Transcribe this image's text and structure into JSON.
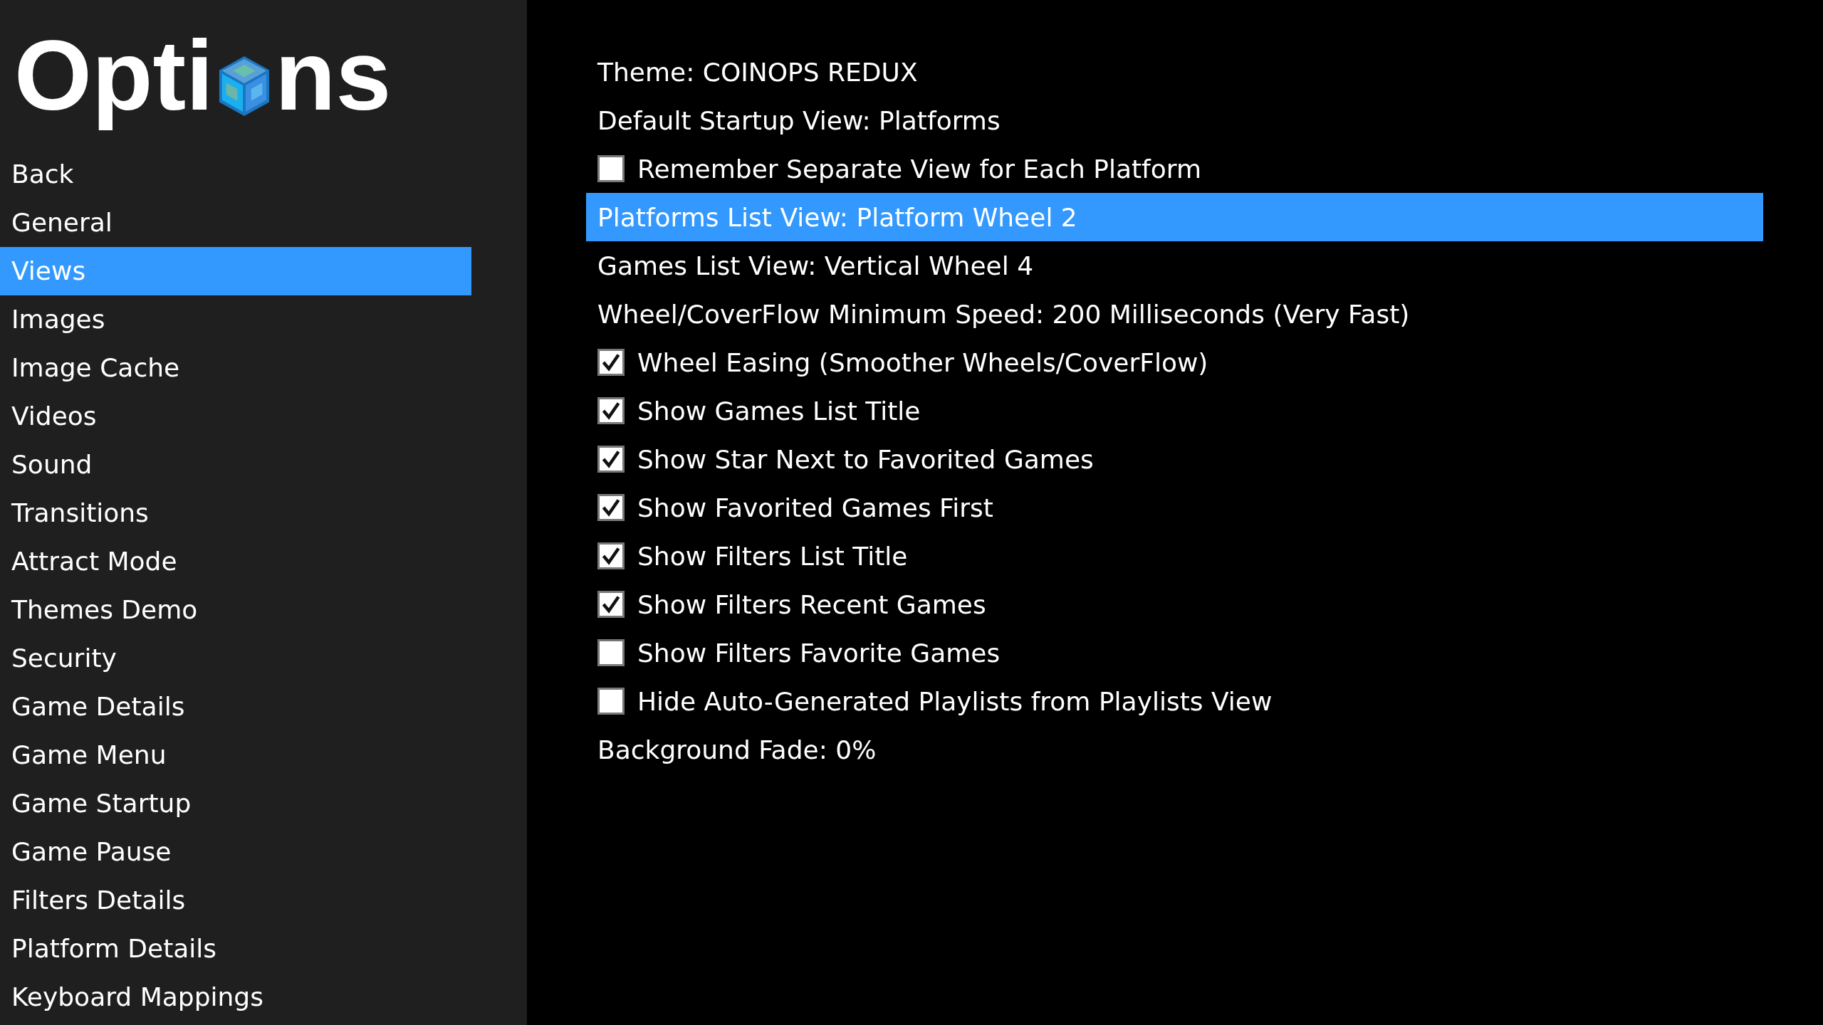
{
  "sidebar": {
    "title_before": "Opti",
    "title_after": "ns",
    "items": [
      {
        "label": "Back",
        "selected": false
      },
      {
        "label": "General",
        "selected": false
      },
      {
        "label": "Views",
        "selected": true
      },
      {
        "label": "Images",
        "selected": false
      },
      {
        "label": "Image Cache",
        "selected": false
      },
      {
        "label": "Videos",
        "selected": false
      },
      {
        "label": "Sound",
        "selected": false
      },
      {
        "label": "Transitions",
        "selected": false
      },
      {
        "label": "Attract Mode",
        "selected": false
      },
      {
        "label": "Themes Demo",
        "selected": false
      },
      {
        "label": "Security",
        "selected": false
      },
      {
        "label": "Game Details",
        "selected": false
      },
      {
        "label": "Game Menu",
        "selected": false
      },
      {
        "label": "Game Startup",
        "selected": false
      },
      {
        "label": "Game Pause",
        "selected": false
      },
      {
        "label": "Filters Details",
        "selected": false
      },
      {
        "label": "Platform Details",
        "selected": false
      },
      {
        "label": "Keyboard Mappings",
        "selected": false
      }
    ]
  },
  "options": [
    {
      "kind": "value",
      "label": "Theme: COINOPS REDUX",
      "selected": false
    },
    {
      "kind": "value",
      "label": "Default Startup View: Platforms",
      "selected": false
    },
    {
      "kind": "checkbox",
      "label": "Remember Separate View for Each Platform",
      "checked": false,
      "selected": false
    },
    {
      "kind": "value",
      "label": "Platforms List View: Platform Wheel 2",
      "selected": true
    },
    {
      "kind": "value",
      "label": "Games List View: Vertical Wheel 4",
      "selected": false
    },
    {
      "kind": "value",
      "label": "Wheel/CoverFlow Minimum Speed: 200 Milliseconds (Very Fast)",
      "selected": false
    },
    {
      "kind": "checkbox",
      "label": "Wheel Easing (Smoother Wheels/CoverFlow)",
      "checked": true,
      "selected": false
    },
    {
      "kind": "checkbox",
      "label": "Show Games List Title",
      "checked": true,
      "selected": false
    },
    {
      "kind": "checkbox",
      "label": "Show Star Next to Favorited Games",
      "checked": true,
      "selected": false
    },
    {
      "kind": "checkbox",
      "label": "Show Favorited Games First",
      "checked": true,
      "selected": false
    },
    {
      "kind": "checkbox",
      "label": "Show Filters List Title",
      "checked": true,
      "selected": false
    },
    {
      "kind": "checkbox",
      "label": "Show Filters Recent Games",
      "checked": true,
      "selected": false
    },
    {
      "kind": "checkbox",
      "label": "Show Filters Favorite Games",
      "checked": false,
      "selected": false
    },
    {
      "kind": "checkbox",
      "label": "Hide Auto-Generated Playlists from Playlists View",
      "checked": false,
      "selected": false
    },
    {
      "kind": "value",
      "label": "Background Fade: 0%",
      "selected": false
    }
  ]
}
